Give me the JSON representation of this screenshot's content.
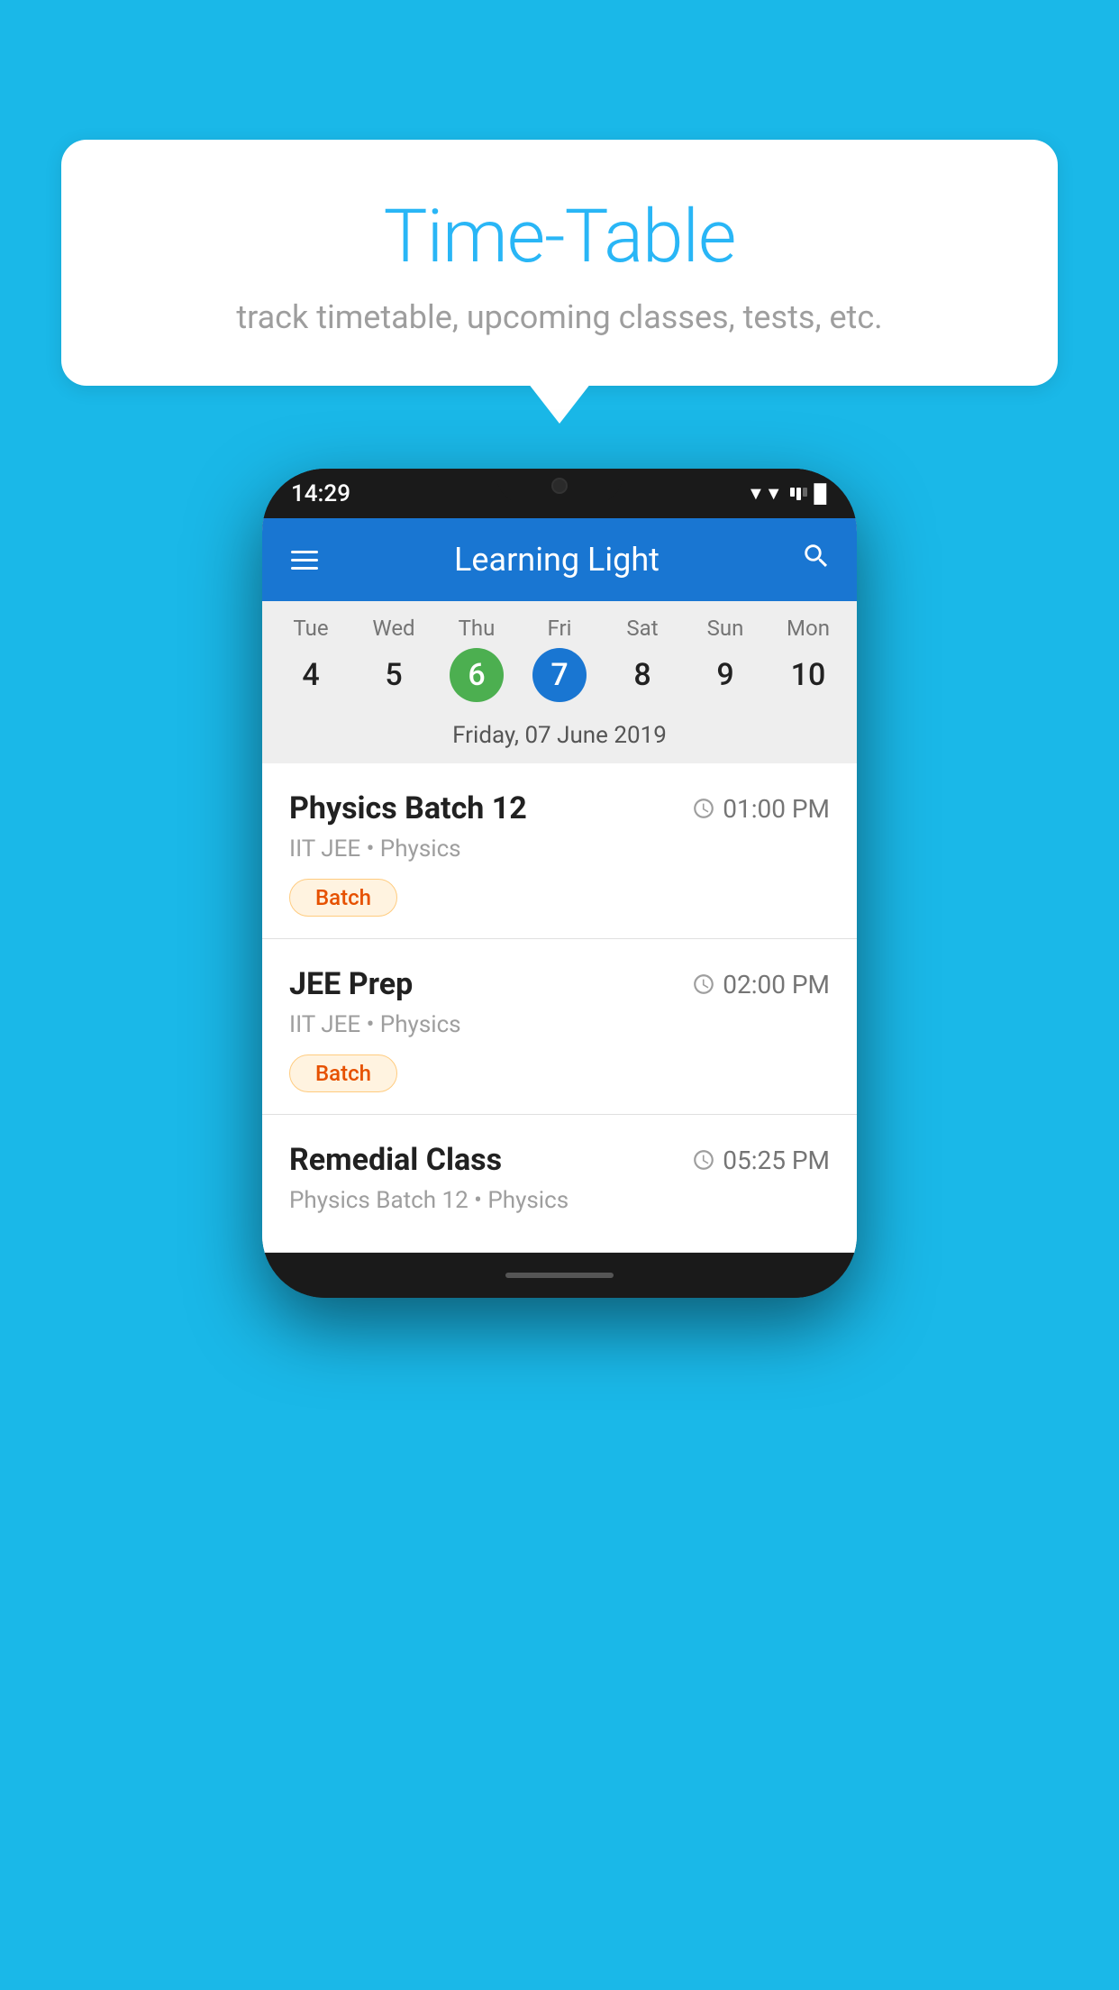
{
  "background_color": "#1ab8e8",
  "speech_bubble": {
    "title": "Time-Table",
    "subtitle": "track timetable, upcoming classes, tests, etc."
  },
  "phone": {
    "status_bar": {
      "time": "14:29",
      "wifi": "▲",
      "signal": "▲",
      "battery": "▌"
    },
    "app_bar": {
      "title": "Learning Light",
      "menu_label": "menu",
      "search_label": "search"
    },
    "calendar": {
      "days": [
        {
          "label": "Tue",
          "number": "4",
          "state": "normal"
        },
        {
          "label": "Wed",
          "number": "5",
          "state": "normal"
        },
        {
          "label": "Thu",
          "number": "6",
          "state": "today"
        },
        {
          "label": "Fri",
          "number": "7",
          "state": "selected"
        },
        {
          "label": "Sat",
          "number": "8",
          "state": "normal"
        },
        {
          "label": "Sun",
          "number": "9",
          "state": "normal"
        },
        {
          "label": "Mon",
          "number": "10",
          "state": "normal"
        }
      ],
      "selected_date_label": "Friday, 07 June 2019"
    },
    "schedule_items": [
      {
        "title": "Physics Batch 12",
        "time": "01:00 PM",
        "subtitle": "IIT JEE • Physics",
        "badge": "Batch"
      },
      {
        "title": "JEE Prep",
        "time": "02:00 PM",
        "subtitle": "IIT JEE • Physics",
        "badge": "Batch"
      },
      {
        "title": "Remedial Class",
        "time": "05:25 PM",
        "subtitle": "Physics Batch 12 • Physics",
        "badge": null
      }
    ]
  }
}
